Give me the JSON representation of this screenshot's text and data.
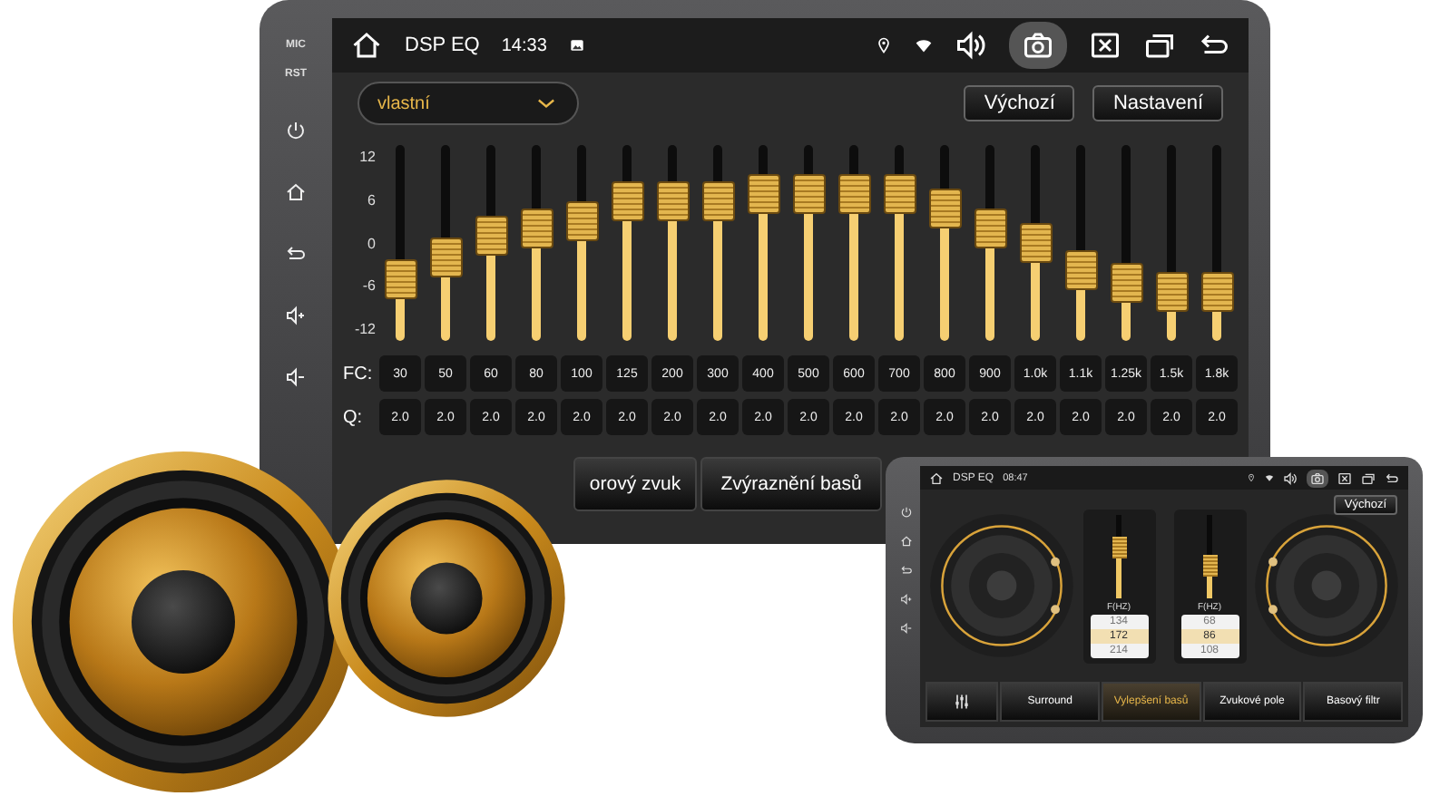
{
  "main_unit": {
    "side_labels": [
      "MIC",
      "RST"
    ],
    "status_bar": {
      "title": "DSP EQ",
      "time": "14:33"
    },
    "preset": {
      "value": "vlastní"
    },
    "buttons": [
      "Výchozí",
      "Nastavení"
    ],
    "scale": [
      "12",
      "6",
      "0",
      "-6",
      "-12"
    ],
    "fc_label": "FC:",
    "q_label": "Q:",
    "bands": [
      {
        "fc": "30",
        "q": "2.0",
        "level": 0.27
      },
      {
        "fc": "50",
        "q": "2.0",
        "level": 0.41
      },
      {
        "fc": "60",
        "q": "2.0",
        "level": 0.55
      },
      {
        "fc": "80",
        "q": "2.0",
        "level": 0.59
      },
      {
        "fc": "100",
        "q": "2.0",
        "level": 0.64
      },
      {
        "fc": "125",
        "q": "2.0",
        "level": 0.77
      },
      {
        "fc": "200",
        "q": "2.0",
        "level": 0.77
      },
      {
        "fc": "300",
        "q": "2.0",
        "level": 0.77
      },
      {
        "fc": "400",
        "q": "2.0",
        "level": 0.81
      },
      {
        "fc": "500",
        "q": "2.0",
        "level": 0.81
      },
      {
        "fc": "600",
        "q": "2.0",
        "level": 0.81
      },
      {
        "fc": "700",
        "q": "2.0",
        "level": 0.81
      },
      {
        "fc": "800",
        "q": "2.0",
        "level": 0.72
      },
      {
        "fc": "900",
        "q": "2.0",
        "level": 0.59
      },
      {
        "fc": "1.0k",
        "q": "2.0",
        "level": 0.5
      },
      {
        "fc": "1.1k",
        "q": "2.0",
        "level": 0.32
      },
      {
        "fc": "1.25k",
        "q": "2.0",
        "level": 0.24
      },
      {
        "fc": "1.5k",
        "q": "2.0",
        "level": 0.19
      },
      {
        "fc": "1.8k",
        "q": "2.0",
        "level": 0.19
      }
    ],
    "modes": [
      "orový zvuk",
      "Zvýraznění basů"
    ]
  },
  "second_unit": {
    "status_bar": {
      "title": "DSP EQ",
      "time": "08:47"
    },
    "button": "Výchozí",
    "pickers": [
      {
        "label": "F(HZ)",
        "level": 0.62,
        "values": [
          {
            "text": "134",
            "selected": false
          },
          {
            "text": "172",
            "selected": true
          },
          {
            "text": "214",
            "selected": false
          }
        ]
      },
      {
        "label": "F(HZ)",
        "level": 0.35,
        "values": [
          {
            "text": "68",
            "selected": false
          },
          {
            "text": "86",
            "selected": true
          },
          {
            "text": "108",
            "selected": false
          }
        ]
      }
    ],
    "tabs": [
      {
        "kind": "icon",
        "selected": false
      },
      {
        "kind": "text",
        "label": "Surround",
        "selected": false
      },
      {
        "kind": "text",
        "label": "Vylepšení basů",
        "selected": true
      },
      {
        "kind": "text",
        "label": "Zvukové pole",
        "selected": false
      },
      {
        "kind": "text",
        "label": "Basový filtr",
        "selected": false
      }
    ]
  }
}
